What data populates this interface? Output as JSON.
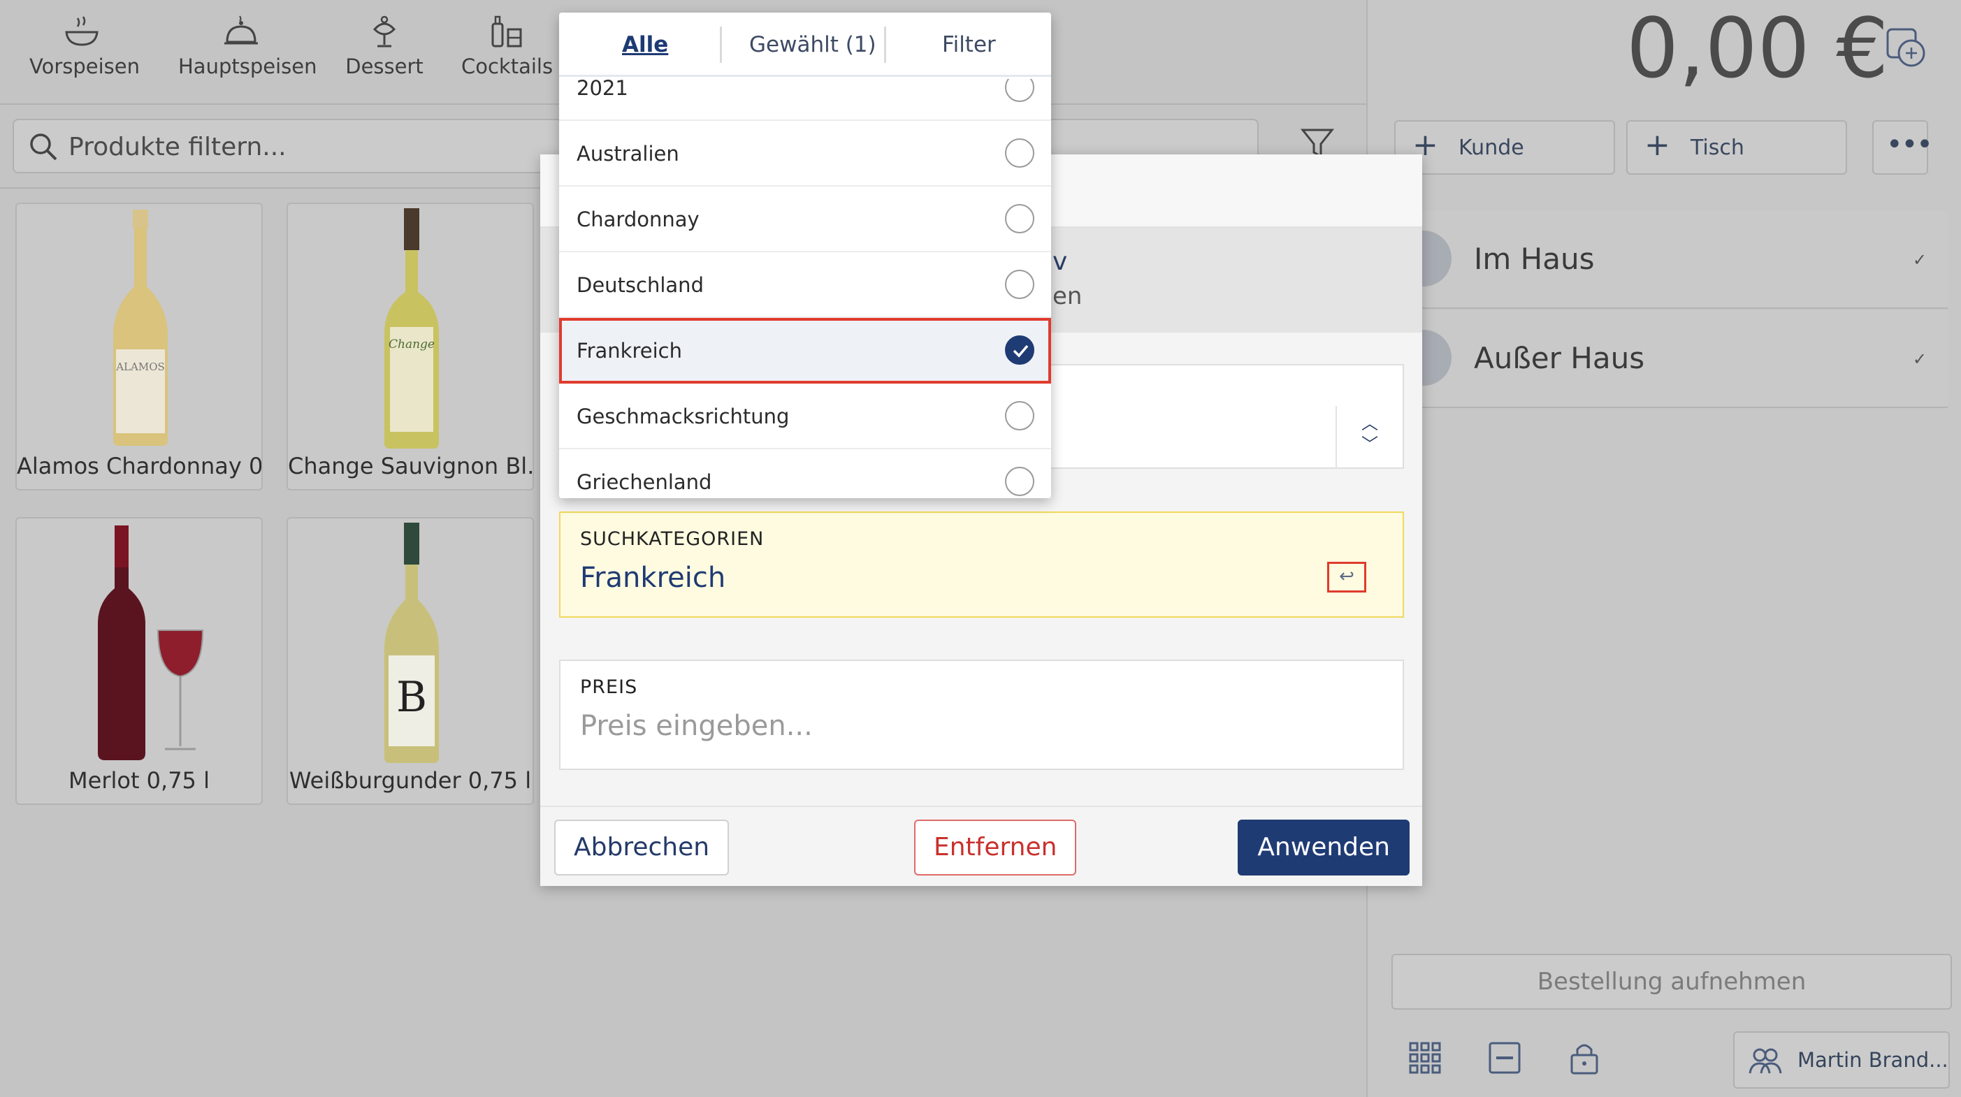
{
  "categories": [
    "Vorspeisen",
    "Hauptspeisen",
    "Dessert",
    "Cocktails"
  ],
  "search": {
    "placeholder": "Produkte filtern..."
  },
  "products": [
    {
      "name": "Alamos Chardonnay 0..."
    },
    {
      "name": "Change Sauvignon Bl..."
    },
    {
      "name": "Merlot 0,75 l"
    },
    {
      "name": "Weißburgunder 0,75 l"
    }
  ],
  "order": {
    "total": "0,00 €",
    "customer_label": "Kunde",
    "table_label": "Tisch",
    "rows": [
      {
        "label": "Im Haus"
      },
      {
        "label": "Außer Haus"
      }
    ],
    "take_order": "Bestellung aufnehmen",
    "user": "Martin Brand..."
  },
  "dropdown": {
    "tabs": [
      "Alle",
      "Gewählt (1)",
      "Filter"
    ],
    "options": [
      {
        "label": "2021",
        "selected": false
      },
      {
        "label": "Australien",
        "selected": false
      },
      {
        "label": "Chardonnay",
        "selected": false
      },
      {
        "label": "Deutschland",
        "selected": false
      },
      {
        "label": "Frankreich",
        "selected": true
      },
      {
        "label": "Geschmacksrichtung",
        "selected": false
      },
      {
        "label": "Griechenland",
        "selected": false
      }
    ]
  },
  "modal": {
    "sel_frag1": "v",
    "sel_frag2": "en",
    "search_categories_caption": "SUCHKATEGORIEN",
    "search_categories_value": "Frankreich",
    "price_caption": "PREIS",
    "price_placeholder": "Preis eingeben...",
    "cancel": "Abbrechen",
    "remove": "Entfernen",
    "apply": "Anwenden"
  },
  "colors": {
    "accent": "#1f3b74",
    "highlight": "#e03b2d",
    "danger": "#c9302c",
    "category_bg": "#fefbe0"
  }
}
